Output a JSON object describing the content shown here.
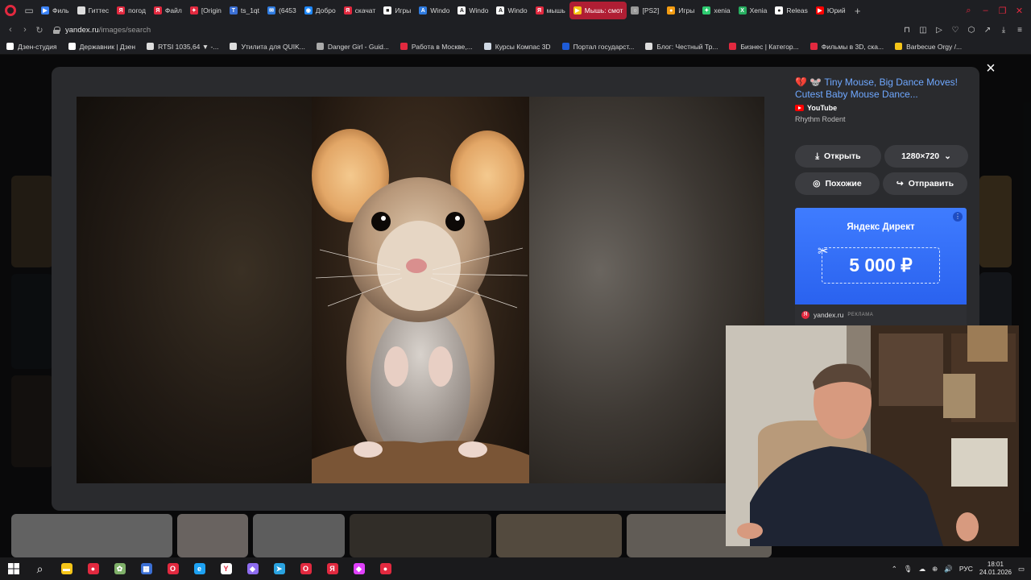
{
  "browser": {
    "tabs": [
      {
        "label": "Филь",
        "color": "#3b82f6",
        "glyph": "▶"
      },
      {
        "label": "Гиттес",
        "color": "#dddddd",
        "glyph": ""
      },
      {
        "label": "погод",
        "color": "#e2293f",
        "glyph": "Я"
      },
      {
        "label": "Файл",
        "color": "#e2293f",
        "glyph": "Я"
      },
      {
        "label": "[Origin",
        "color": "#e2293f",
        "glyph": "✦"
      },
      {
        "label": "ts_1qt",
        "color": "#3b6fd4",
        "glyph": "T"
      },
      {
        "label": "(6453",
        "color": "#2f7be0",
        "glyph": "✉"
      },
      {
        "label": "Добро",
        "color": "#1e88ff",
        "glyph": "◉"
      },
      {
        "label": "скачат",
        "color": "#e2293f",
        "glyph": "Я"
      },
      {
        "label": "Игры",
        "color": "#ffffff",
        "glyph": "■"
      },
      {
        "label": "Windo",
        "color": "#2f7be0",
        "glyph": "A"
      },
      {
        "label": "Windo",
        "color": "#ffffff",
        "glyph": "A"
      },
      {
        "label": "Windo",
        "color": "#ffffff",
        "glyph": "A"
      },
      {
        "label": "мышь",
        "color": "#e2293f",
        "glyph": "Я"
      },
      {
        "label": "Мышь: смот",
        "color": "#f5c518",
        "glyph": "▶",
        "active": true
      },
      {
        "label": "[PS2]",
        "color": "#999999",
        "glyph": "○"
      },
      {
        "label": "Игры",
        "color": "#f39c12",
        "glyph": "●"
      },
      {
        "label": "xenia",
        "color": "#2ecc71",
        "glyph": "✦"
      },
      {
        "label": "Xenia",
        "color": "#27ae60",
        "glyph": "X"
      },
      {
        "label": "Releas",
        "color": "#ffffff",
        "glyph": "●"
      },
      {
        "label": "Юрий",
        "color": "#ff0000",
        "glyph": "▶"
      }
    ],
    "url_host": "yandex.ru",
    "url_path": "/images/search",
    "bookmarks": [
      {
        "label": "Дзен-студия",
        "color": "#ffffff"
      },
      {
        "label": "Державник | Дзен",
        "color": "#ffffff"
      },
      {
        "label": "RTSI 1035,64 ▼ -...",
        "color": "#dddddd"
      },
      {
        "label": "Утилита для QUIK...",
        "color": "#dddddd"
      },
      {
        "label": "Danger Girl - Guid...",
        "color": "#aaaaaa"
      },
      {
        "label": "Работа в Москве,...",
        "color": "#e2293f"
      },
      {
        "label": "Курсы Компас 3D",
        "color": "#cfd8e3"
      },
      {
        "label": "Портал государст...",
        "color": "#1e5bd6"
      },
      {
        "label": "Блог: Честный Тр...",
        "color": "#dddddd"
      },
      {
        "label": "Бизнес | Категор...",
        "color": "#e2293f"
      },
      {
        "label": "Фильмы в 3D, ска...",
        "color": "#e2293f"
      },
      {
        "label": "Barbecue Orgy /...",
        "color": "#f5c518"
      }
    ]
  },
  "viewer": {
    "source_emoji": "💔 🐭",
    "source_title": "Tiny Mouse, Big Dance Moves! Cutest Baby Mouse Dance...",
    "platform": "YouTube",
    "channel": "Rhythm Rodent",
    "open_label": "Открыть",
    "size_label": "1280×720",
    "similar_label": "Похожие",
    "share_label": "Отправить",
    "close_glyph": "×"
  },
  "ad": {
    "brand": "Яндекс Директ",
    "amount": "5 000 ₽",
    "domain": "yandex.ru",
    "tag": "РЕКЛАМА"
  },
  "taskbar": {
    "apps": [
      {
        "name": "file-explorer",
        "color": "#f5c518",
        "glyph": "▬"
      },
      {
        "name": "record",
        "color": "#e2293f",
        "glyph": "●"
      },
      {
        "name": "app-green",
        "color": "#7fb069",
        "glyph": "✿"
      },
      {
        "name": "calculator",
        "color": "#3b6fd4",
        "glyph": "▦"
      },
      {
        "name": "opera",
        "color": "#e2293f",
        "glyph": "O"
      },
      {
        "name": "edge",
        "color": "#1da1f2",
        "glyph": "e"
      },
      {
        "name": "yandex-browser",
        "color": "#ffffff",
        "glyph": "Y"
      },
      {
        "name": "gamepad",
        "color": "#8e6cf0",
        "glyph": "◆"
      },
      {
        "name": "telegram",
        "color": "#2aa3e0",
        "glyph": "➤"
      },
      {
        "name": "opera-gx",
        "color": "#e2293f",
        "glyph": "O"
      },
      {
        "name": "yandex",
        "color": "#e2293f",
        "glyph": "Я"
      },
      {
        "name": "app-pink",
        "color": "#e040fb",
        "glyph": "◆"
      },
      {
        "name": "recorder",
        "color": "#e2293f",
        "glyph": "●"
      }
    ],
    "lang": "РУС",
    "time": "18:01",
    "date": "24.01.2026"
  }
}
